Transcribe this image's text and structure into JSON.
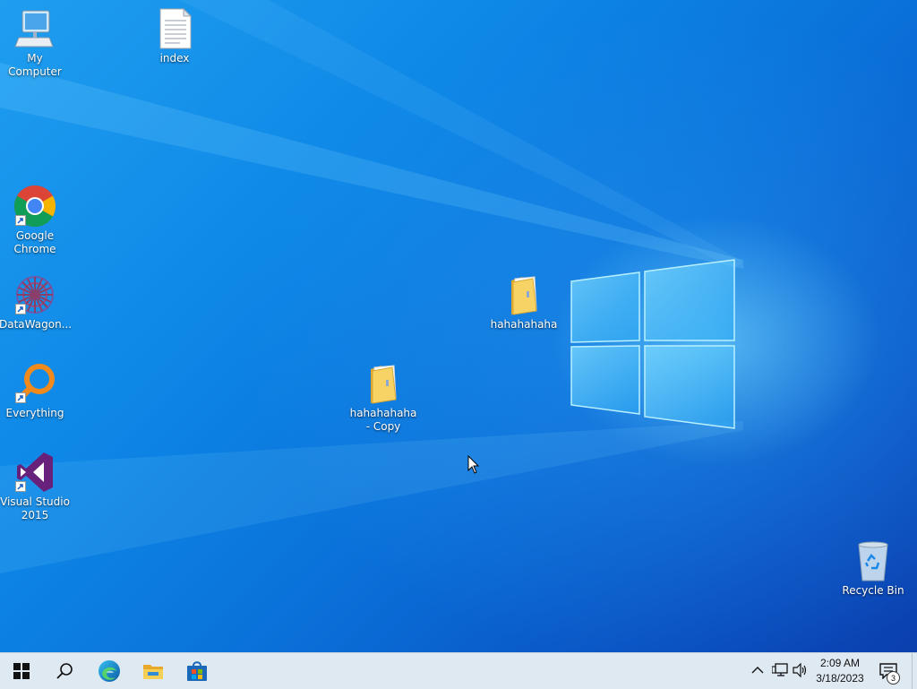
{
  "desktop": {
    "icons": [
      {
        "label": "My Computer",
        "icon": "computer-icon"
      },
      {
        "label": "index",
        "icon": "text-file-icon"
      },
      {
        "label": "Google Chrome",
        "icon": "chrome-icon"
      },
      {
        "label": "DataWagon...",
        "icon": "datawagon-icon"
      },
      {
        "label": "Everything",
        "icon": "everything-search-icon"
      },
      {
        "label": "Visual Studio 2015",
        "icon": "visual-studio-icon"
      },
      {
        "label": "hahahahaha",
        "icon": "folder-icon"
      },
      {
        "label": "hahahahaha - Copy",
        "icon": "folder-icon"
      },
      {
        "label": "Recycle Bin",
        "icon": "recycle-bin-icon"
      }
    ]
  },
  "taskbar": {
    "pinned": [
      {
        "name": "Start",
        "icon": "windows-start-icon"
      },
      {
        "name": "Search",
        "icon": "search-icon"
      },
      {
        "name": "Microsoft Edge",
        "icon": "edge-icon"
      },
      {
        "name": "File Explorer",
        "icon": "file-explorer-icon"
      },
      {
        "name": "Microsoft Store",
        "icon": "store-icon"
      }
    ],
    "tray": {
      "time": "2:09 AM",
      "date": "3/18/2023",
      "notification_count": "3"
    }
  },
  "colors": {
    "accent": "#0a78e0",
    "taskbar": "#dfe9f2"
  }
}
